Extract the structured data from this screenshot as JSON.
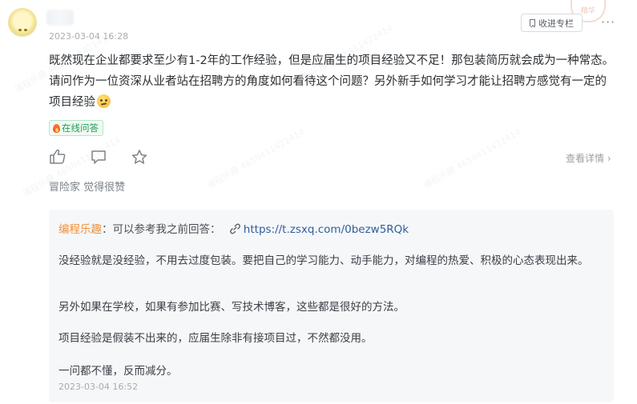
{
  "post": {
    "time": "2023-03-04 16:28",
    "collect_label": "收进专栏",
    "more_label": "···",
    "stamp_label": "精华",
    "question": "既然现在企业都要求至少有1-2年的工作经验，但是应届生的项目经验又不足！那包装简历就会成为一种常态。请问作为一位资深从业者站在招聘方的角度如何看待这个问题？另外新手如何学习才能让招聘方感觉有一定的项目经验",
    "emoji_icon": "thinking-face-icon",
    "tag_label": "在线问答",
    "view_detail": "查看详情 ›",
    "likers": "冒险家 觉得很赞"
  },
  "answer": {
    "author": "编程乐趣",
    "intro": "：可以参考我之前回答：",
    "url": "https://t.zsxq.com/0bezw5RQk",
    "paragraphs": [
      "没经验就是没经验，不用去过度包装。要把自己的学习能力、动手能力，对编程的热爱、积极的心态表现出来。",
      "另外如果在学校，如果有参加比赛、写技术博客，这些都是很好的方法。",
      "项目经验是假装不出来的，应届生除非有接项目过，不然都没用。",
      "一问都不懂，反而减分。"
    ],
    "time": "2023-03-04 16:52"
  },
  "colors": {
    "accent_orange": "#f0923a",
    "link_blue": "#2f5e9c",
    "tag_green": "#1f9d55"
  }
}
